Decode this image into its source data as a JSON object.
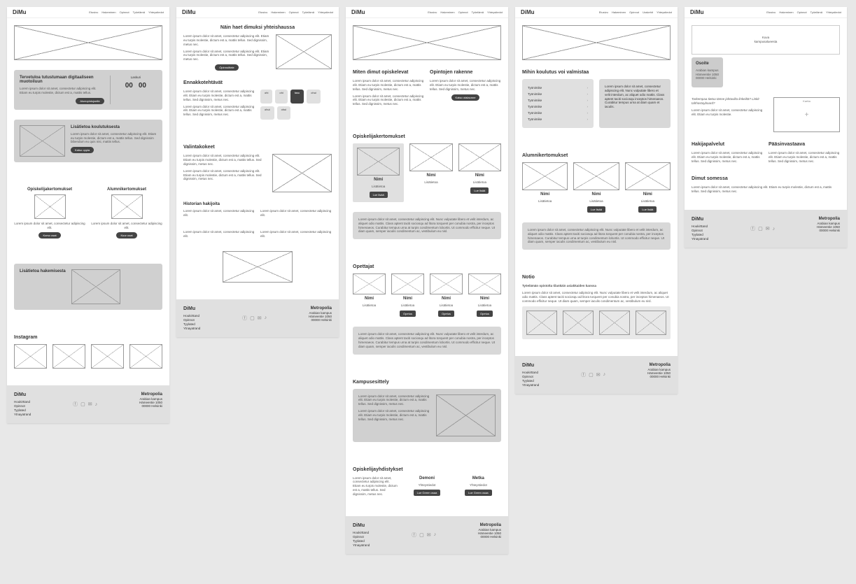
{
  "logo": "DiMu",
  "nav": {
    "a": [
      "Etusivu",
      "Hakeminen",
      "Opinnot",
      "Työelämä",
      "Yhteystiedot"
    ],
    "d": [
      "Etusivu",
      "Hakeminen",
      "Opinnot",
      "Urakehit",
      "Yhteystiedot"
    ]
  },
  "p1": {
    "welcome": {
      "title": "Tervetuloa tutustumaan digitaaliseen muotoiluun",
      "body": "Lorem ipsum dolor sit amet, consectetur adipiscing elit. Etiam eu turpis molestie, dictum est a, mattis tellus.",
      "btn": "Alueopintojaelle",
      "cd_label": "Laskuri",
      "cd1": "00",
      "cd2": "00"
    },
    "more": {
      "title": "Lisätietoa koulutuksesta",
      "body": "Lorem ipsum dolor sit amet, consectetur adipiscing elit. Etiam eu turpis molestie, dictum est a, mattis tellus. Sed dignissim bibendum eu quis nisi, mattis tellus.",
      "btn": "Katso oppia"
    },
    "opisk": {
      "title": "Opiskelijakertomukset",
      "body": "Lorem ipsum dolor sit amet, consectetur adipiscing elit.",
      "btn": "Korso osat"
    },
    "alum": {
      "title": "Alumnikertomukset",
      "body": "Lorem ipsum dolor sit amet, consectetur adipiscing elit.",
      "btn": "Kuur usat"
    },
    "haku": {
      "title": "Lisätietoa hakemisesta"
    },
    "insta": "Instagram"
  },
  "p2": {
    "heading": "Näin haet dimuksi yhteishaussa",
    "body1": "Lorem ipsum dolor sit amet, consectetur adipiscing elit. Etiam eu turpis molestie, dictum est a, mattis tellus. Sed dignissim, metus nec.",
    "body2": "Lorem ipsum dolor sit amet, consectetur adipiscing elit. Etiam eu turpis molestie, dictum est a, mattis tellus. Sed dignissim, metus nec.",
    "btn": "Opinnoittele",
    "ennakko": "Ennakkotehtävät",
    "tags": [
      "ohi",
      "ohi",
      "tasu",
      "ohui",
      "ohui",
      "ohui"
    ],
    "valinta": "Valintakokeet",
    "hist": "Historian hakijoita",
    "q1": "Lorem ipsum dolor sit amet, consectetur adipiscing elit.",
    "q2": "Lorem ipsum dolor sit amet, consectetur adipiscing elit.",
    "q3": "Lorem ipsum dolor sit amet, consectetur adipiscing elit."
  },
  "p3": {
    "h1": "Miten dimut opiskelevat",
    "h2": "Opintojen rakenne",
    "body": "Lorem ipsum dolor sit amet, consectetur adipiscing elit. Etiam eu turpis molestie, dictum est a, mattis tellus. Sed dignissim, metus nec.",
    "btn": "Katso otalaunne",
    "opisk": "Opiskelijakertomukset",
    "name": "Nimi",
    "info": "Lisätietoa",
    "lue": "Lue lisää",
    "quote": "Lorem ipsum dolor sit amet, consectetur adipiscing elit. Nunc vulputate libero et velit interdum, ac aliquet odio mattis. Class aptent taciti sociosqu ad litora torquent per conubia nostra, per inceptos himenaeos. Curabitur tempus urna at turpis condimentum lobortis. Ut commodo efficitur neque. Ut diam quam, semper iaculis condimentum ac, vestibulum eu nisl.",
    "opet": "Opettajat",
    "opeta": "Opetus",
    "kampus": "Kampusesittely",
    "yhd": "Opiskelijayhdistykset",
    "demoni": "Demoni",
    "metka": "Metka",
    "ytied": "Yhteystiedot",
    "jbtn": "Lue Green osaa"
  },
  "p4": {
    "h": "Mihin koulutus voi valmistaa",
    "jobs": [
      "Työnimike",
      "Työnimike",
      "Työnimike",
      "Työnimike",
      "Työnimike",
      "Työnimike"
    ],
    "callout": "Lorem ipsum dolor sit amet, consectetur adipiscing elit. Nunc vulputate libero et velit interdum, ac aliquet odio mattis. Class aptent taciti sociosqu inceptos himenaeos. Curabitur tempus urna at diam quam et iaculis.",
    "alum": "Alumnikertomukset",
    "name": "Nimi",
    "info": "Lisätietoa",
    "lue": "Lue lisää",
    "quote": "Lorem ipsum dolor sit amet, consectetur adipiscing elit. Nunc vulputate libero et velit interdum, ac aliquet odio mattis. Class aptent taciti sociosqu ad litora torquent per conubia nostra, per inceptos himenaeos. Curabitur tempus urna at turpis condimentum lobortis. Ut commodo efficitur neque. Ut diam quam, semper iaculis condimentum ac, vestibulum eu nisl.",
    "notio": "Notio",
    "nsub": "Työelämän opistolta tilankäin asiakkaiden kanssa",
    "nbody": "Lorem ipsum dolor sit amet, consectetur adipiscing elit. Nunc vulputate libero et velit interdum, ac aliquet odio mattis. Class aptent taciti sociosqu ad litora torquent per conubia nostra, per inceptos himenaeos. Ut commodo efficitur neque. Ut diam quam, semper iaculis condimentum ac, vestibulum eu nisl."
  },
  "p5": {
    "map_label": "Kuva\nkampusalueesta",
    "tab": "Osoite",
    "addr": "Arabian kampus\nHämeentie 1050\n00000 Helsinki",
    "q": "Tarkempaa tietoa tänne johtavilta linkeiltä? Linkit tahhostayboard?",
    "body": "Lorem ipsum dolor sit amet, consectetur adipiscing elit. Etiam eu turpis molestie.",
    "kartta": "Kartta",
    "hak": "Hakijapalvelut",
    "paa": "Pääsinvastaava",
    "som": "Dimut somessa",
    "gen": "Lorem ipsum dolor sit amet, consectetur adipiscing elit. Etiam eu turpis molestie, dictum est a, mattis tellus. Sed dignissim, metus nec."
  },
  "footer": {
    "links": [
      "Houkirttand",
      "Opinnot",
      "Tyylated",
      "Ytnayatrand"
    ],
    "metro": "Metropolia",
    "addr": "Arabian kampus\nHämeentie 1050\n00000 Helsinki"
  }
}
